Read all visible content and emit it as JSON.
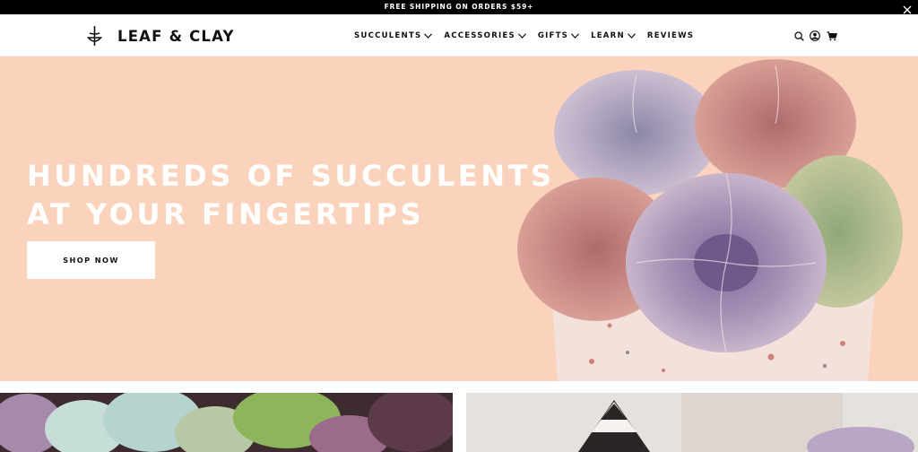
{
  "announcement": {
    "text": "FREE SHIPPING ON ORDERS $59+"
  },
  "brand": {
    "name": "LEAF & CLAY"
  },
  "nav": {
    "items": [
      {
        "label": "SUCCULENTS",
        "has_dropdown": true
      },
      {
        "label": "ACCESSORIES",
        "has_dropdown": true
      },
      {
        "label": "GIFTS",
        "has_dropdown": true
      },
      {
        "label": "LEARN",
        "has_dropdown": true
      },
      {
        "label": "REVIEWS",
        "has_dropdown": false
      }
    ]
  },
  "utility": {
    "icons": [
      "search-icon",
      "account-icon",
      "cart-icon"
    ]
  },
  "hero": {
    "title_line1": "HUNDREDS OF SUCCULENTS",
    "title_line2": "AT YOUR FINGERTIPS",
    "cta_label": "SHOP NOW"
  },
  "colors": {
    "hero_bg": "#fbd3bd",
    "announcement_bg": "#000000",
    "text": "#111111"
  }
}
